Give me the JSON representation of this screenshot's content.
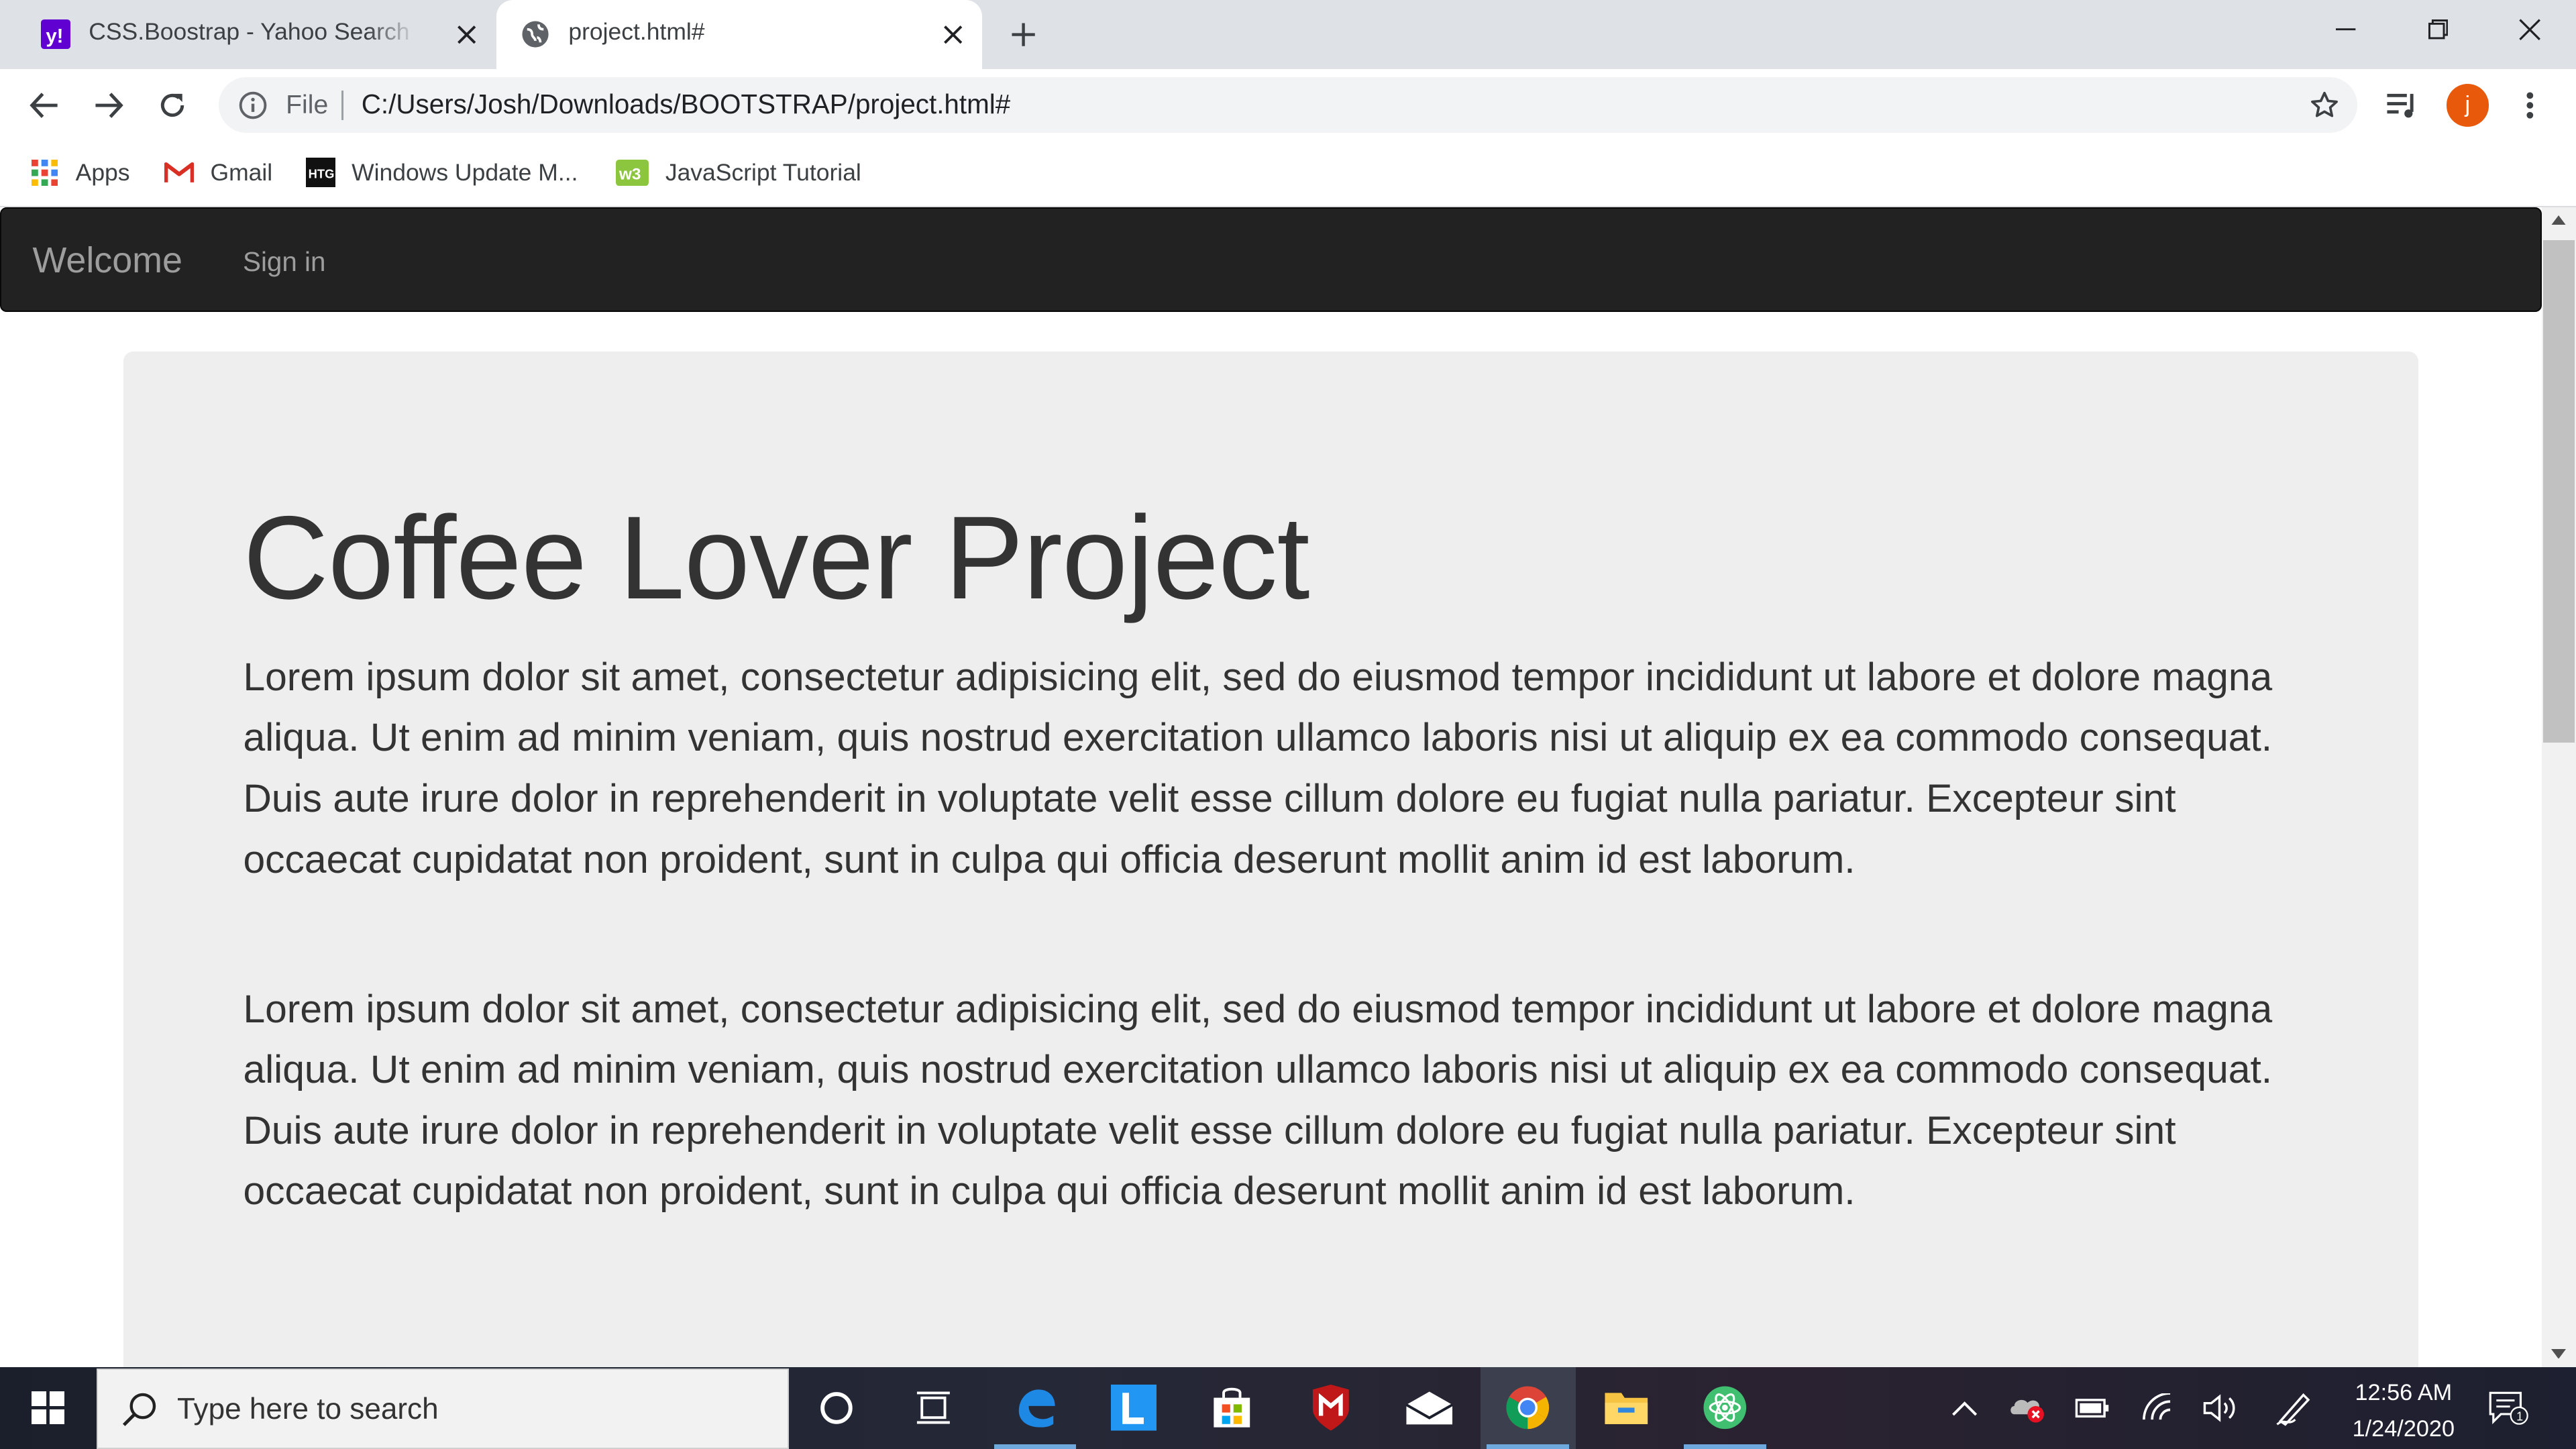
{
  "browser": {
    "tabs": [
      {
        "title": "CSS.Boostrap - Yahoo Search Results",
        "favicon": "yahoo-icon",
        "active": false
      },
      {
        "title": "project.html#",
        "favicon": "globe-icon",
        "active": true
      }
    ],
    "address": {
      "scheme_label": "File",
      "url": "C:/Users/Josh/Downloads/BOOTSTRAP/project.html#"
    },
    "profile_initial": "j",
    "bookmarks": [
      {
        "label": "Apps",
        "icon": "apps-grid-icon"
      },
      {
        "label": "Gmail",
        "icon": "gmail-icon"
      },
      {
        "label": "Windows Update M...",
        "icon": "htg-icon"
      },
      {
        "label": "JavaScript Tutorial",
        "icon": "w3-icon"
      }
    ]
  },
  "page": {
    "navbar": {
      "brand": "Welcome",
      "link": "Sign in"
    },
    "jumbotron": {
      "title": "Coffee Lover Project",
      "paragraphs": [
        "Lorem ipsum dolor sit amet, consectetur adipisicing elit, sed do eiusmod tempor incididunt ut labore et dolore magna aliqua. Ut enim ad minim veniam, quis nostrud exercitation ullamco laboris nisi ut aliquip ex ea commodo consequat. Duis aute irure dolor in reprehenderit in voluptate velit esse cillum dolore eu fugiat nulla pariatur. Excepteur sint occaecat cupidatat non proident, sunt in culpa qui officia deserunt mollit anim id est laborum.",
        "Lorem ipsum dolor sit amet, consectetur adipisicing elit, sed do eiusmod tempor incididunt ut labore et dolore magna aliqua. Ut enim ad minim veniam, quis nostrud exercitation ullamco laboris nisi ut aliquip ex ea commodo consequat. Duis aute irure dolor in reprehenderit in voluptate velit esse cillum dolore eu fugiat nulla pariatur. Excepteur sint occaecat cupidatat non proident, sunt in culpa qui officia deserunt mollit anim id est laborum."
      ]
    }
  },
  "taskbar": {
    "search_placeholder": "Type here to search",
    "time": "12:56 AM",
    "date": "1/24/2020",
    "notification_count": "1"
  },
  "colors": {
    "navbar_bg": "#222222",
    "jumbotron_bg": "#eeeeee",
    "tab_strip_bg": "#dee1e6",
    "profile_avatar": "#e8590c"
  }
}
